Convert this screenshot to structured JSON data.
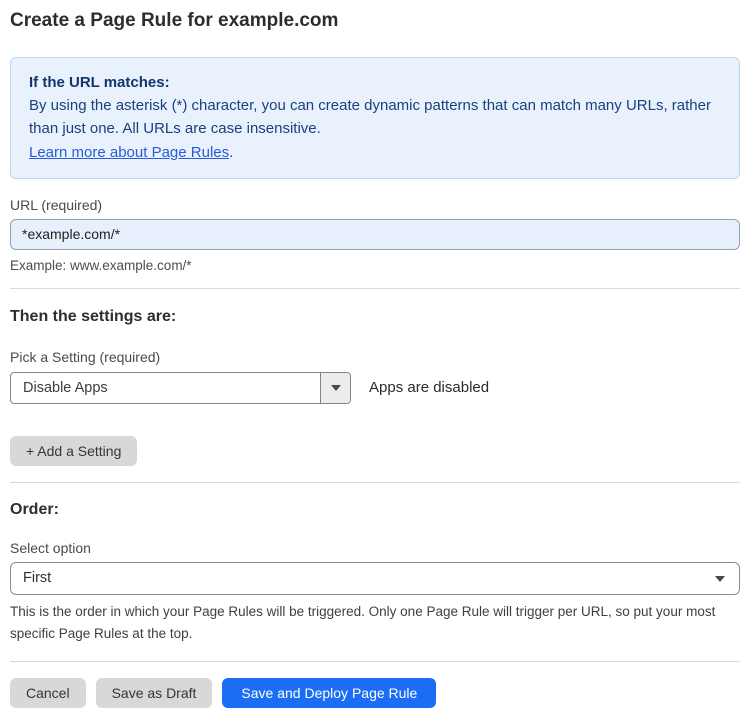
{
  "page": {
    "title": "Create a Page Rule for example.com"
  },
  "info_box": {
    "heading": "If the URL matches:",
    "body": "By using the asterisk (*) character, you can create dynamic patterns that can match many URLs, rather than just one. All URLs are case insensitive.",
    "link_label": "Learn more about Page Rules",
    "link_suffix": "."
  },
  "url_field": {
    "label": "URL (required)",
    "value": "*example.com/*",
    "helper": "Example: www.example.com/*"
  },
  "settings_section": {
    "heading": "Then the settings are:",
    "picker_label": "Pick a Setting (required)",
    "picker_value": "Disable Apps",
    "status_text": "Apps are disabled",
    "add_button_label": "+ Add a Setting"
  },
  "order_section": {
    "heading": "Order:",
    "select_label": "Select option",
    "select_value": "First",
    "helper": "This is the order in which your Page Rules will be triggered. Only one Page Rule will trigger per URL, so put your most specific Page Rules at the top."
  },
  "actions": {
    "cancel_label": "Cancel",
    "save_draft_label": "Save as Draft",
    "save_deploy_label": "Save and Deploy Page Rule"
  },
  "icons": {
    "dropdown_arrow": "triangle-down",
    "select_chevron": "triangle-down"
  },
  "colors": {
    "primary_button": "#1b6ef3",
    "info_background": "#e9f2fc",
    "info_border": "#b9d7f1",
    "info_text": "#1b3f7f",
    "link": "#2a5bd7",
    "input_background": "#e7f0fc",
    "gray_button": "#d8d8d8"
  }
}
